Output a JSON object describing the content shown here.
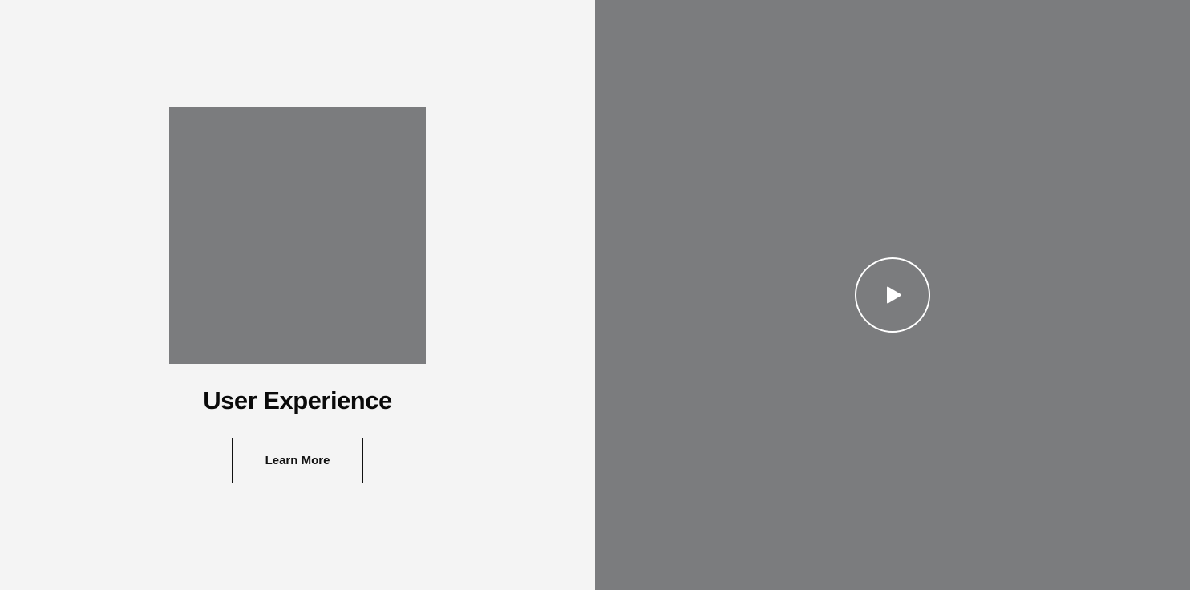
{
  "feature": {
    "title": "User Experience",
    "button_label": "Learn More"
  },
  "video": {
    "play_icon": "play-icon"
  },
  "colors": {
    "left_background": "#f4f4f4",
    "placeholder": "#7b7c7e",
    "right_background": "#7b7c7e",
    "text": "#0a0a0a",
    "play_icon": "#ffffff"
  }
}
